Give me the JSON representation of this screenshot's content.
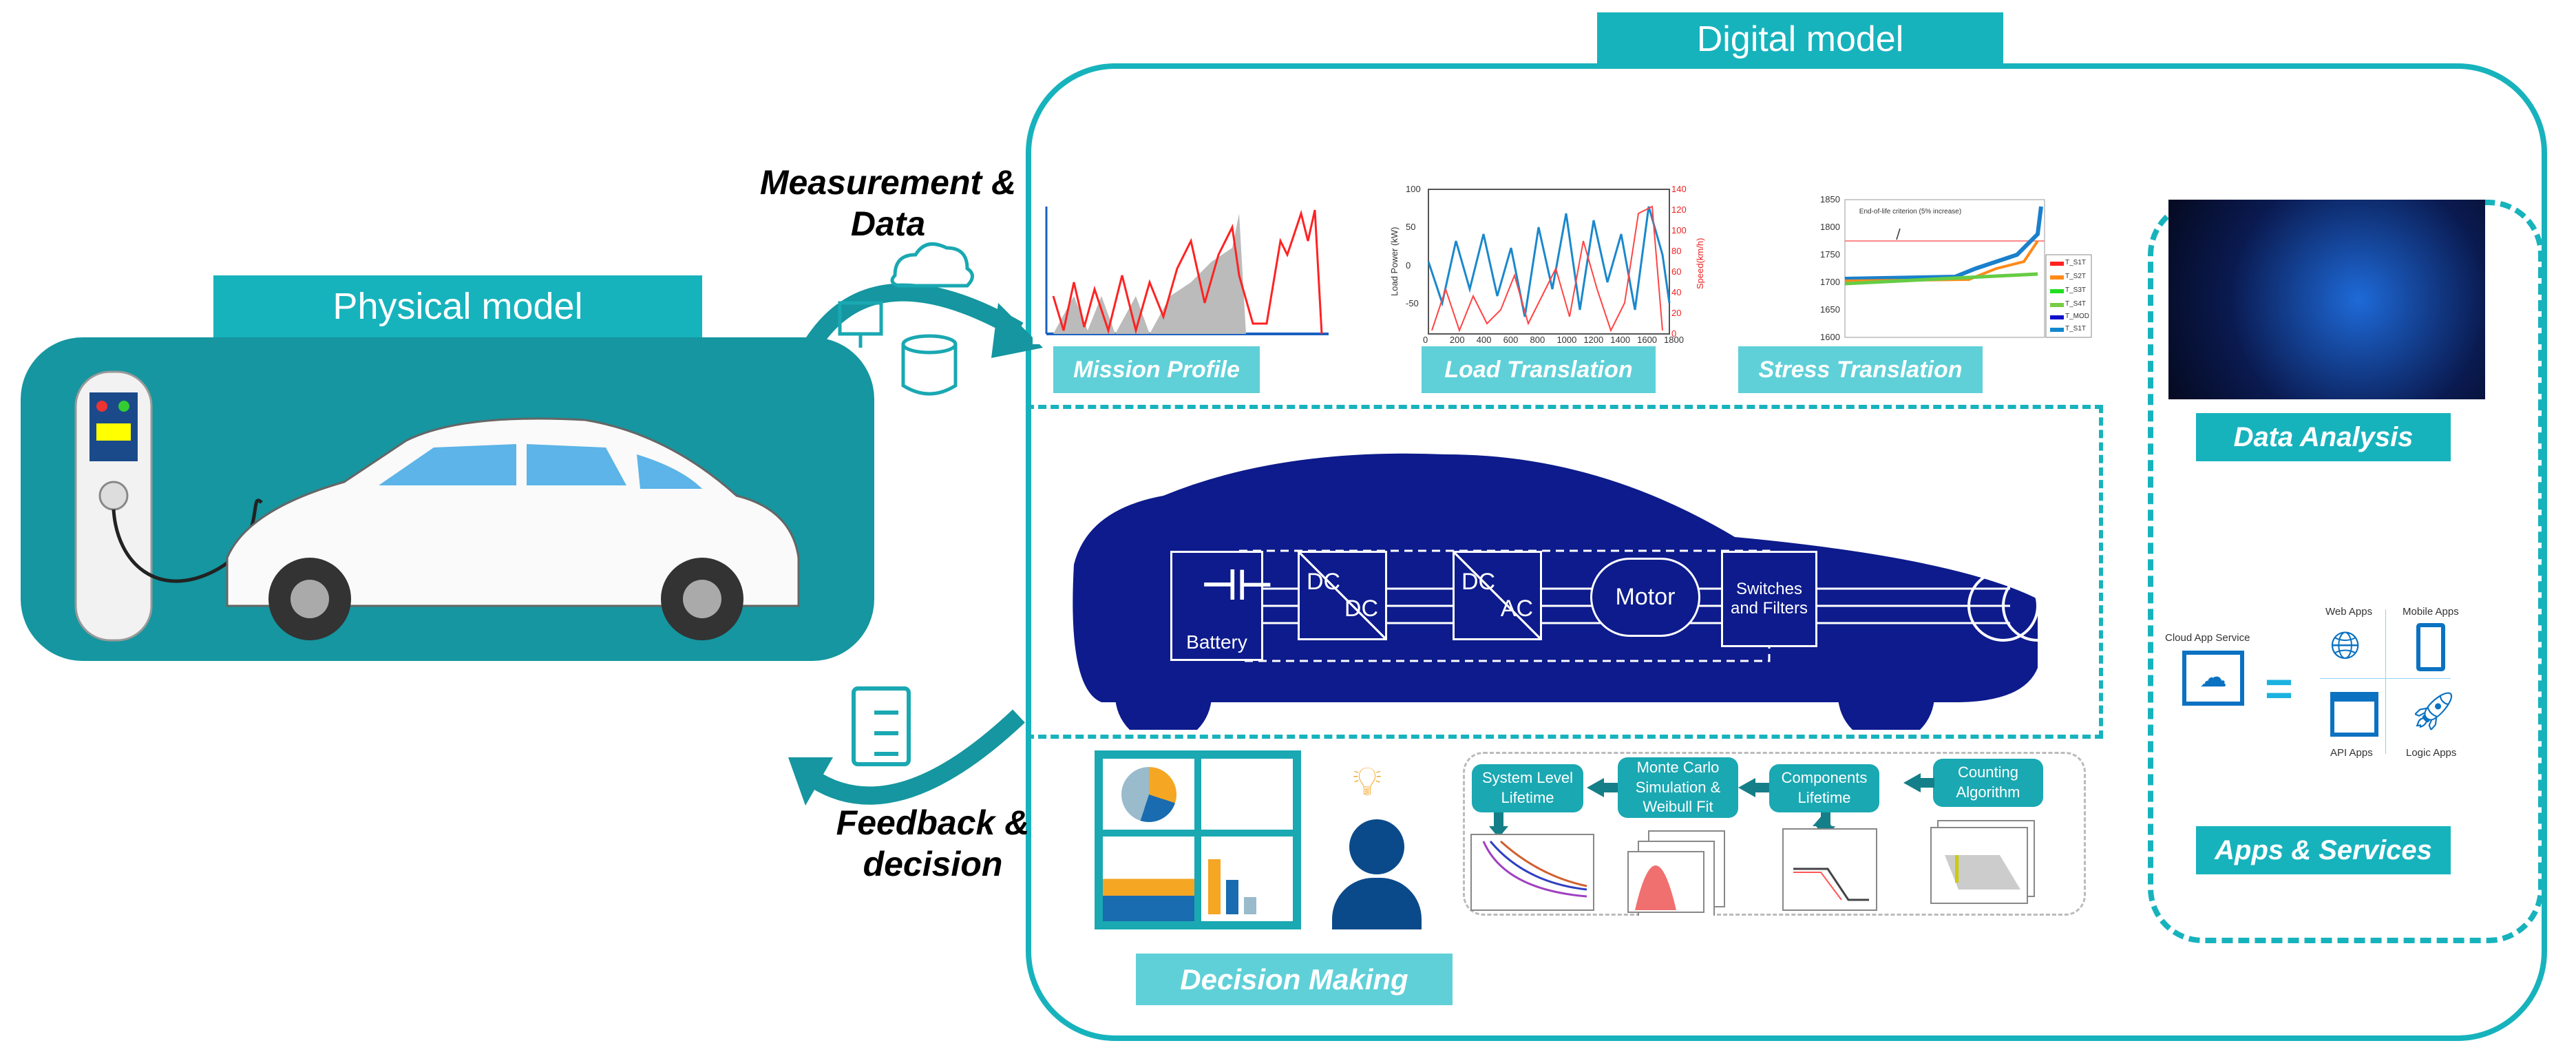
{
  "physical": {
    "title": "Physical model"
  },
  "digital": {
    "title": "Digital model"
  },
  "arrows": {
    "measurement": "Measurement & Data",
    "feedback": "Feedback & decision"
  },
  "top_panels": [
    {
      "label": "Mission Profile"
    },
    {
      "label": "Load Translation"
    },
    {
      "label": "Stress Translation"
    }
  ],
  "load_chart": {
    "y_ticks": [
      "100",
      "50",
      "0",
      "-50"
    ],
    "x_ticks": [
      "0",
      "200",
      "400",
      "600",
      "800",
      "1000",
      "1200",
      "1400",
      "1600",
      "1800"
    ],
    "y2_ticks": [
      "140",
      "120",
      "100",
      "80",
      "60",
      "40",
      "20",
      "0"
    ],
    "ylabel": "Load Power (kW)",
    "y2label": "Speed(km/h)"
  },
  "stress_chart": {
    "y_ticks": [
      "1850",
      "1800",
      "1750",
      "1700",
      "1650",
      "1600"
    ],
    "annotation": "End-of-life criterion (5% increase)",
    "legend": [
      "T_S1T",
      "T_S2T",
      "T_S3T",
      "T_S4T",
      "T_MOD",
      "T_S1T"
    ],
    "legend_colors": [
      "#ff2020",
      "#ff8a1a",
      "#22dd22",
      "#7ccc44",
      "#1a1acc",
      "#1a80cc"
    ]
  },
  "powertrain": {
    "battery": "Battery",
    "dcdc": [
      "DC",
      "DC"
    ],
    "dcac": [
      "DC",
      "AC"
    ],
    "motor": "Motor",
    "switches": "Switches and Filters"
  },
  "right": {
    "data_analysis": "Data Analysis",
    "apps_services": "Apps & Services",
    "cloud_label": "Cloud App Service",
    "apps": [
      "Web Apps",
      "Mobile Apps",
      "API Apps",
      "Logic Apps"
    ]
  },
  "bottom": {
    "decision_making": "Decision Making",
    "lifetime_steps": [
      "System Level Lifetime",
      "Monte Carlo Simulation & Weibull Fit",
      "Components Lifetime",
      "Counting Algorithm"
    ]
  },
  "colors": {
    "teal": "#17b3bd",
    "teal_dark": "#1596a0",
    "navy": "#0d1b8c",
    "light_teal": "#5fd0d8"
  }
}
